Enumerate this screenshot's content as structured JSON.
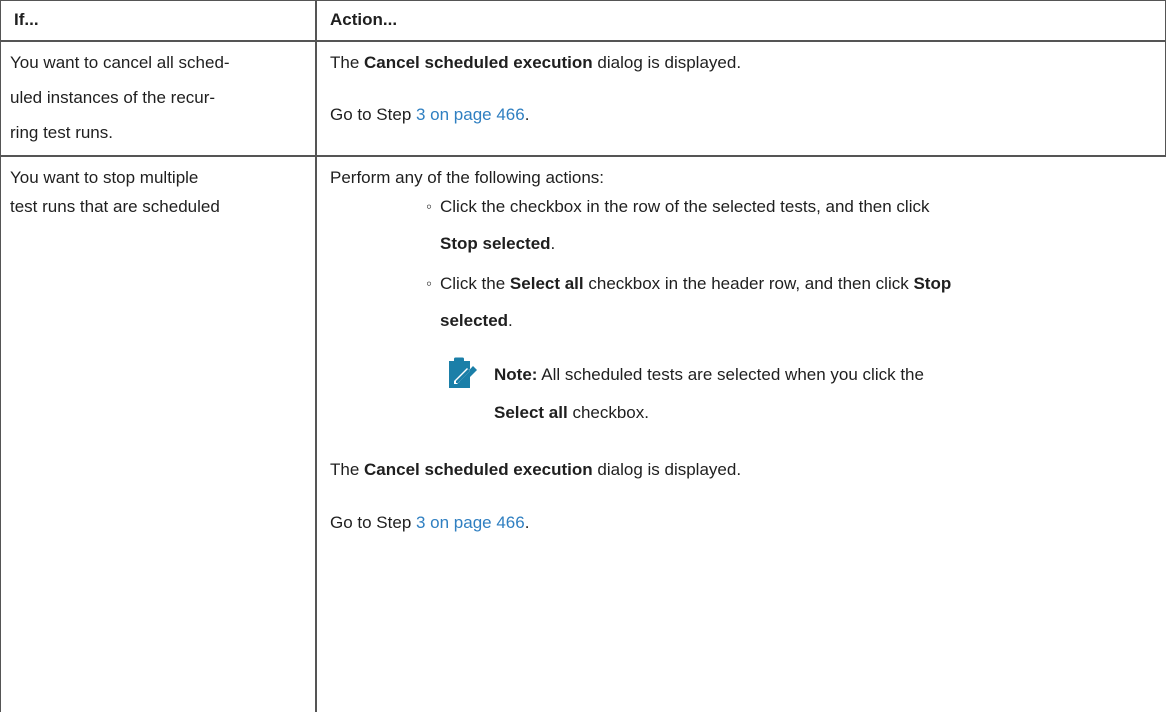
{
  "table": {
    "headers": [
      "If...",
      "Action..."
    ],
    "row1": {
      "if_lines": [
        "You want to cancel all sched-",
        "uled instances of the recur-",
        "ring test runs."
      ],
      "action_1": {
        "prefix": "The ",
        "bold": "Cancel scheduled execution",
        "suffix": " dialog is displayed."
      },
      "action_2": {
        "prefix": "Go to Step ",
        "link": "3 on page 466",
        "suffix": "."
      }
    },
    "row2": {
      "if_lines": [
        "You want to stop multiple",
        "test runs that are scheduled"
      ],
      "intro": "Perform any of the following actions:",
      "bullet_1": {
        "line1": "Click the checkbox in the row of the selected tests, and then click",
        "line2_bold": "Stop selected",
        "line2_suffix": "."
      },
      "bullet_2": {
        "p1": "Click the ",
        "b1": "Select all",
        "p2": " checkbox in the header row, and then click ",
        "b2": "Stop",
        "line2_bold": "selected",
        "line2_suffix": "."
      },
      "note": {
        "label": "Note:",
        "line1": " All scheduled tests are selected when you click the",
        "line2_bold": "Select all",
        "line2_suffix": " checkbox."
      },
      "action_3": {
        "prefix": "The ",
        "bold": "Cancel scheduled execution",
        "suffix": " dialog is displayed."
      },
      "action_4": {
        "prefix": "Go to Step ",
        "link": "3 on page 466",
        "suffix": "."
      }
    }
  },
  "colors": {
    "link": "#2f7fc1",
    "note_icon": "#1b7fa8"
  },
  "icons": {
    "note": "pencil-note-icon"
  }
}
